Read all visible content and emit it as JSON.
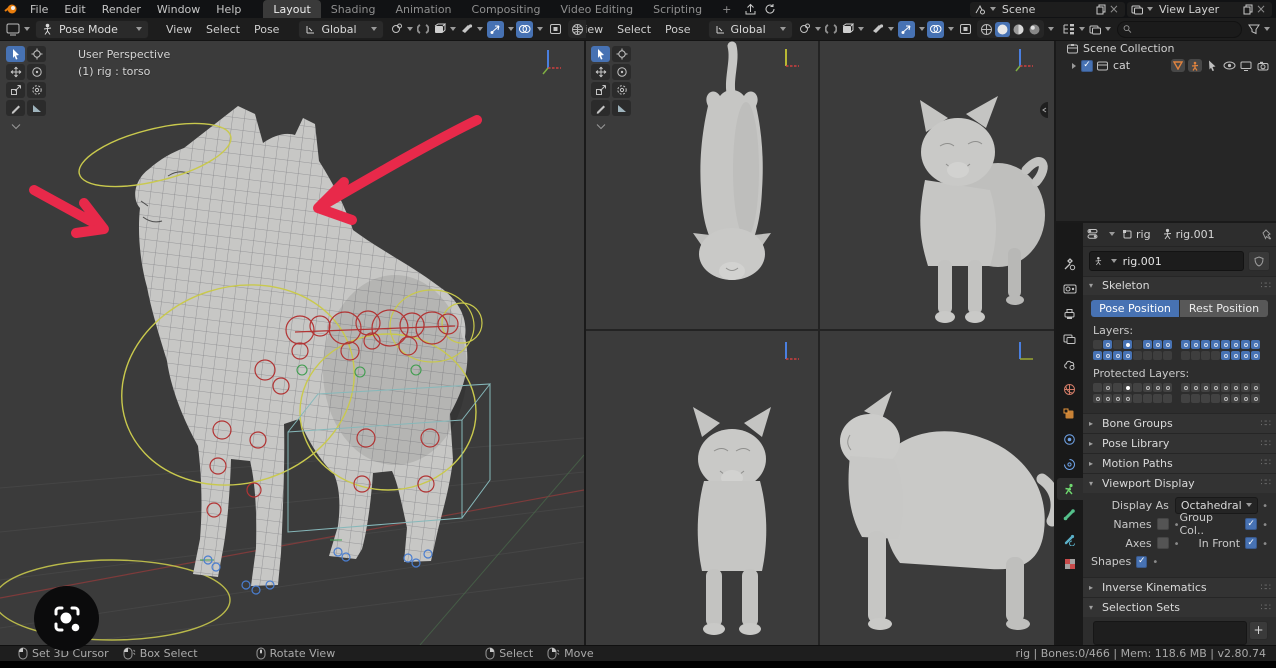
{
  "colors": {
    "accent": "#4772b3",
    "annotation_red": "#e8294a",
    "bone_yellow": "#c9c94d",
    "viewport_bg": "#3b3b3b"
  },
  "topbar": {
    "menus": [
      "File",
      "Edit",
      "Render",
      "Window",
      "Help"
    ],
    "workspaces": [
      "Layout",
      "Shading",
      "Animation",
      "Compositing",
      "Video Editing",
      "Scripting"
    ],
    "active_workspace": "Layout",
    "add_workspace_label": "+",
    "scene_label": "Scene",
    "view_layer_label": "View Layer"
  },
  "viewport_header": {
    "mode": "Pose Mode",
    "menus": [
      "View",
      "Select",
      "Pose"
    ],
    "orientation": "Global"
  },
  "viewport2_header": {
    "menus": [
      "View",
      "Select",
      "Pose"
    ],
    "orientation": "Global"
  },
  "viewport": {
    "view_label": "User Perspective",
    "object_label": "(1) rig : torso"
  },
  "outliner": {
    "root_label": "Scene Collection",
    "items": [
      {
        "name": "cat",
        "checked": true
      }
    ],
    "search_placeholder": ""
  },
  "properties": {
    "breadcrumb": {
      "object": "rig",
      "data": "rig.001"
    },
    "id_name": "rig.001",
    "skeleton": {
      "title": "Skeleton",
      "pose_button": "Pose Position",
      "rest_button": "Rest Position",
      "layers_label": "Layers:",
      "protected_label": "Protected Layers:",
      "layers": {
        "blocks": [
          [
            [
              0,
              1,
              0,
              2,
              0,
              1,
              1,
              1
            ],
            [
              1,
              1,
              1,
              1,
              0,
              0,
              0,
              0
            ]
          ],
          [
            [
              1,
              1,
              1,
              1,
              1,
              1,
              1,
              1
            ],
            [
              0,
              0,
              0,
              0,
              1,
              1,
              1,
              1
            ]
          ]
        ]
      },
      "protected_layers": {
        "blocks": [
          [
            [
              0,
              1,
              0,
              2,
              0,
              1,
              1,
              1
            ],
            [
              1,
              1,
              1,
              1,
              0,
              0,
              0,
              0
            ]
          ],
          [
            [
              1,
              1,
              1,
              1,
              1,
              1,
              1,
              1
            ],
            [
              0,
              0,
              0,
              0,
              1,
              1,
              1,
              1
            ]
          ]
        ]
      }
    },
    "collapsed_panels": [
      "Bone Groups",
      "Pose Library",
      "Motion Paths"
    ],
    "viewport_display": {
      "title": "Viewport Display",
      "display_as_label": "Display As",
      "display_as_value": "Octahedral",
      "options": [
        {
          "label": "Names",
          "checked": false
        },
        {
          "label": "Group Col..",
          "checked": true
        },
        {
          "label": "Axes",
          "checked": false
        },
        {
          "label": "In Front",
          "checked": true
        },
        {
          "label": "Shapes",
          "checked": true
        }
      ]
    },
    "inverse_kinematics_title": "Inverse Kinematics",
    "selection_sets_title": "Selection Sets",
    "selection_sets_add_label": "+"
  },
  "status_bar": {
    "hints": [
      {
        "icon": "mouse-left",
        "label": "Set 3D Cursor"
      },
      {
        "icon": "mouse-left-drag",
        "label": "Box Select"
      },
      {
        "icon": "mouse-middle",
        "label": "Rotate View"
      },
      {
        "icon": "mouse-right",
        "label": "Select"
      },
      {
        "icon": "mouse-right-drag",
        "label": "Move"
      }
    ],
    "info": "rig | Bones:0/466  | Mem: 118.6 MB | v2.80.74"
  }
}
